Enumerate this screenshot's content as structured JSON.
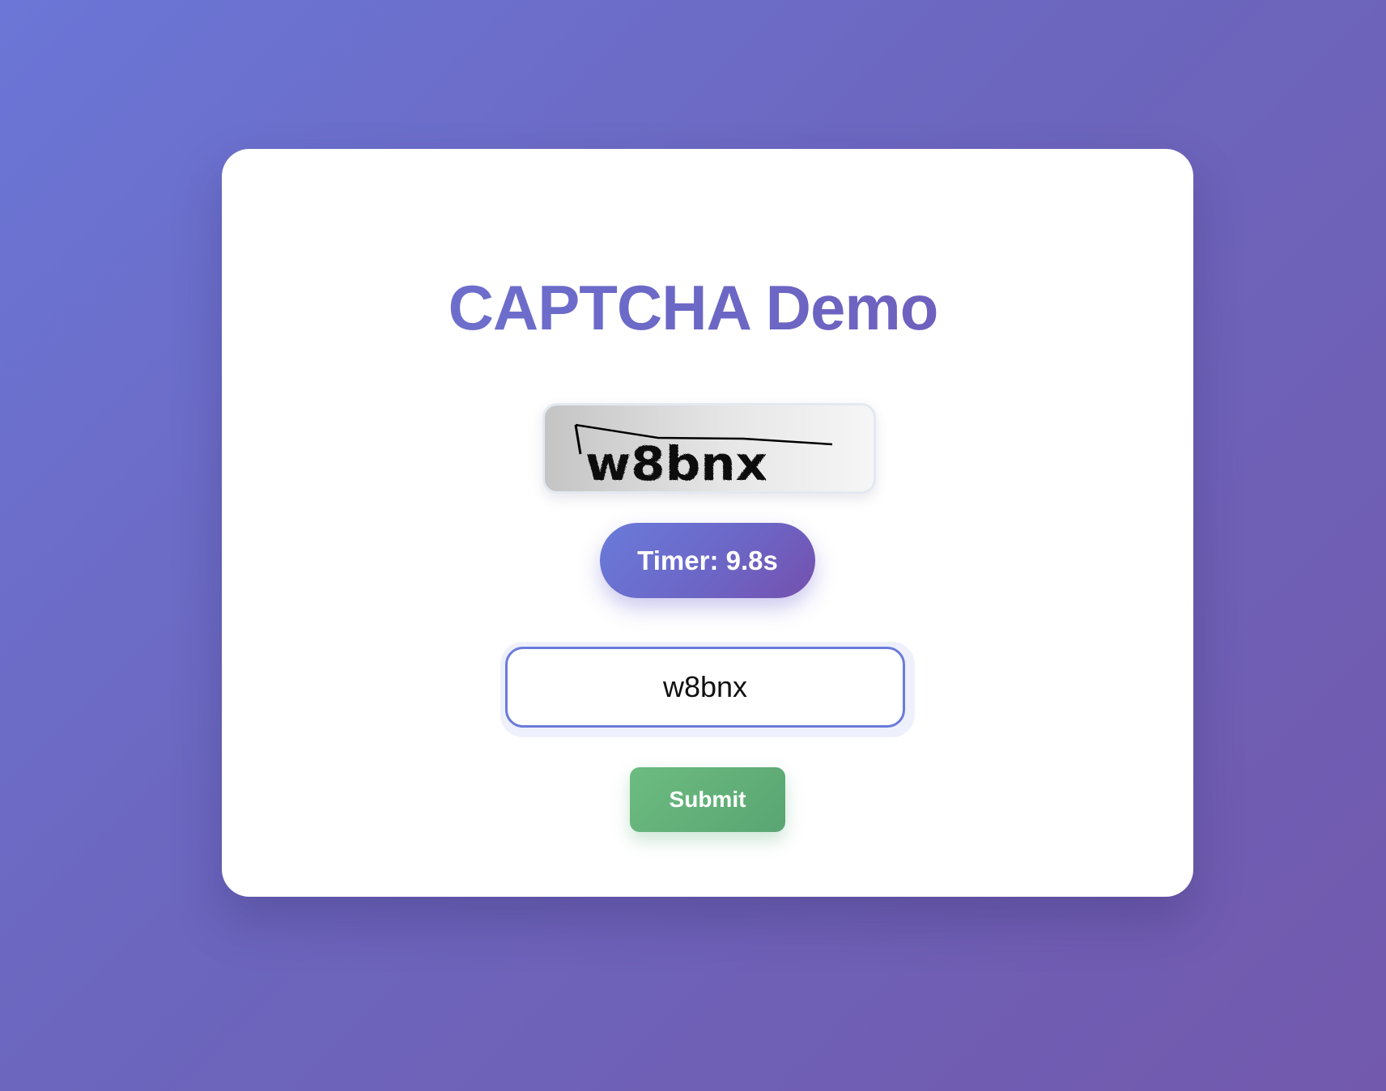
{
  "page": {
    "title": "CAPTCHA Demo"
  },
  "captcha": {
    "text": "w8bnx"
  },
  "timer": {
    "label": "Timer: 9.8s"
  },
  "answer_input": {
    "value": "w8bnx"
  },
  "submit": {
    "label": "Submit"
  },
  "colors": {
    "accent": "#6a7bda",
    "accent_end": "#7550ae",
    "submit": "#62af79"
  }
}
